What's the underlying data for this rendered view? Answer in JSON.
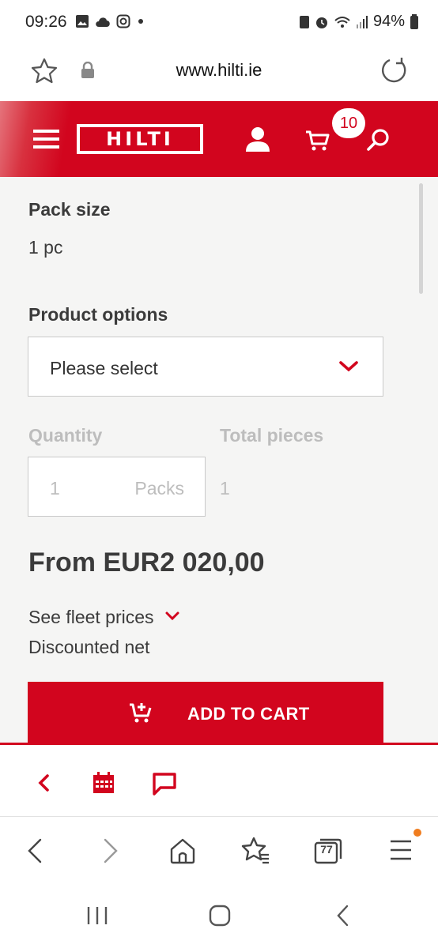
{
  "status_bar": {
    "time": "09:26",
    "battery": "94%"
  },
  "browser": {
    "url": "www.hilti.ie",
    "tabs_count": "77"
  },
  "header": {
    "logo_text": "HILTI",
    "cart_count": "10"
  },
  "product": {
    "pack_size_label": "Pack size",
    "pack_size_value": "1 pc",
    "options_label": "Product options",
    "options_placeholder": "Please select",
    "quantity_label": "Quantity",
    "total_pieces_label": "Total pieces",
    "quantity_value": "1",
    "quantity_unit": "Packs",
    "total_pieces_value": "1",
    "price": "From EUR2 020,00",
    "fleet_prices_link": "See fleet prices",
    "discount_note": "Discounted net",
    "add_to_cart": "ADD TO CART"
  },
  "colors": {
    "brand_red": "#d2051e",
    "content_bg": "#f5f5f4",
    "muted": "#bdbdbd"
  },
  "icons": [
    "star-icon",
    "lock-icon",
    "reload-icon",
    "menu-icon",
    "user-icon",
    "cart-icon",
    "search-icon",
    "chevron-down-icon",
    "add-cart-icon",
    "back-arrow-icon",
    "calendar-icon",
    "chat-icon",
    "browser-back-icon",
    "browser-forward-icon",
    "home-icon",
    "bookmarks-icon",
    "tabs-icon",
    "browser-menu-icon",
    "recent-apps-icon",
    "home-button-icon",
    "system-back-icon"
  ]
}
